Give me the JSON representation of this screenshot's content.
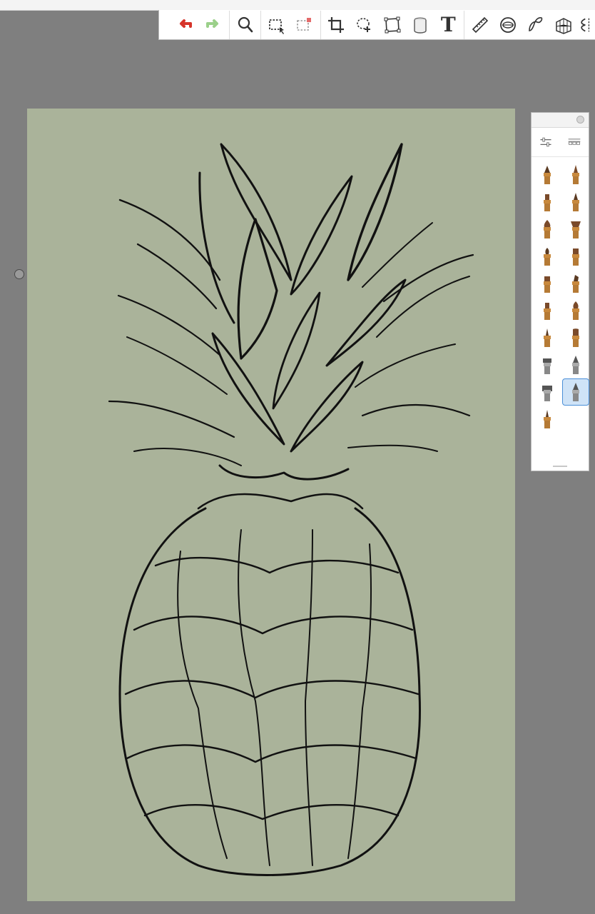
{
  "toolbar": {
    "tools": [
      {
        "name": "undo-icon"
      },
      {
        "name": "redo-icon"
      },
      {
        "name": "zoom-icon"
      },
      {
        "name": "selection-icon"
      },
      {
        "name": "transform-selection-icon"
      },
      {
        "name": "crop-icon"
      },
      {
        "name": "lasso-icon"
      },
      {
        "name": "distort-icon"
      },
      {
        "name": "fill-bucket-icon"
      },
      {
        "name": "text-icon"
      },
      {
        "name": "ruler-icon"
      },
      {
        "name": "ellipse-guide-icon"
      },
      {
        "name": "french-curve-icon"
      },
      {
        "name": "perspective-icon"
      },
      {
        "name": "symmetry-icon"
      }
    ],
    "text_tool_glyph": "T"
  },
  "brush_panel": {
    "brushes": [
      "pencil",
      "pencil-hard",
      "marker",
      "felt-pen",
      "paint-brush",
      "fan-brush",
      "airbrush",
      "flat-brush",
      "chisel-brush",
      "smudge",
      "watercolor",
      "blender",
      "ink-pen",
      "soft-brush",
      "paint-roller",
      "pen-nib",
      "eraser",
      "fountain-pen",
      "graphite-pencil"
    ],
    "selected": "fountain-pen"
  },
  "colors": {
    "workspace": "#7f7f7f",
    "canvas": "#aab39a",
    "ink": "#111111",
    "undo": "#d6342a",
    "redo": "#9bd08a",
    "selection_accent": "#4a8fd8"
  }
}
